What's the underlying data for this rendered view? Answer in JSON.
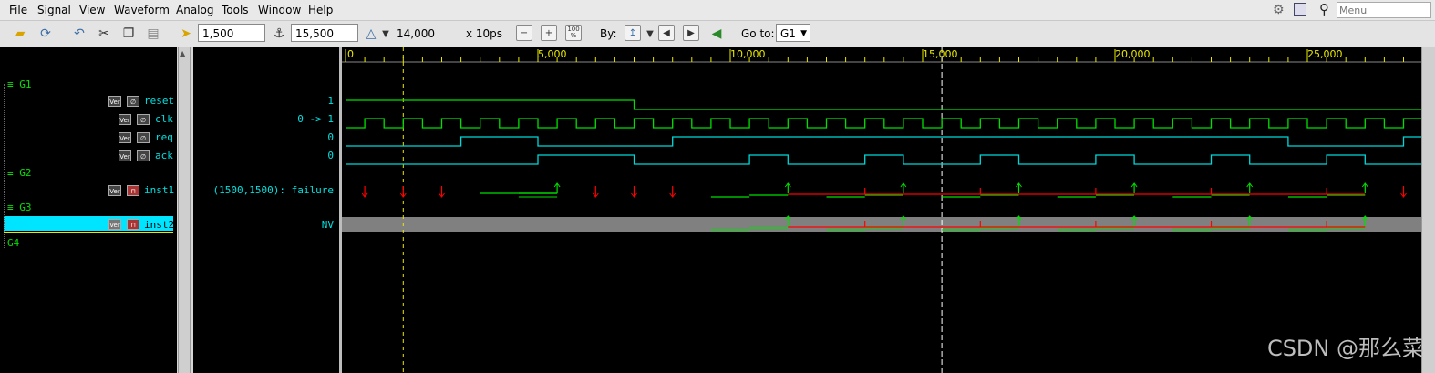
{
  "menu": [
    "File",
    "Signal",
    "View",
    "Waveform",
    "Analog",
    "Tools",
    "Window",
    "Help"
  ],
  "menu_search_placeholder": "Menu",
  "toolbar": {
    "cursor1_value": "1,500",
    "cursor2_value": "15,500",
    "delta_value": "14,000",
    "unit": "x 10ps",
    "by_label": "By:",
    "goto_label": "Go to:",
    "goto_value": "G1",
    "zoom_100": "100\n%"
  },
  "groups": [
    {
      "name": "G1"
    },
    {
      "name": "G2"
    },
    {
      "name": "G3"
    },
    {
      "name": "G4"
    }
  ],
  "signals": [
    {
      "name": "reset",
      "value": "1"
    },
    {
      "name": "clk",
      "value": "0 -> 1"
    },
    {
      "name": "req",
      "value": "0"
    },
    {
      "name": "ack",
      "value": "0"
    },
    {
      "name": "inst1",
      "value": "(1500,1500): failure"
    },
    {
      "name": "inst2",
      "value": "NV"
    }
  ],
  "ruler": [
    "0",
    "5,000",
    "10,000",
    "15,000",
    "20,000",
    "25,000"
  ],
  "watermark": "CSDN @那么菜",
  "colors": {
    "green": "#00e000",
    "cyan": "#00d8d8",
    "red": "#ff0000",
    "yellow": "#e8e800"
  }
}
